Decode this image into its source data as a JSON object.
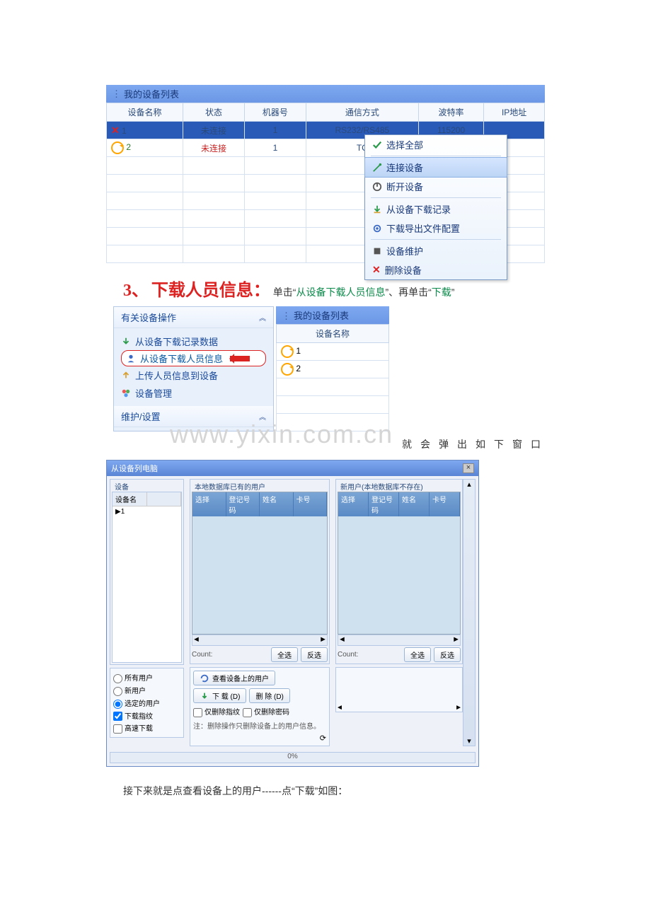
{
  "deviceListTitle": "我的设备列表",
  "table1": {
    "headers": [
      "设备名称",
      "状态",
      "机器号",
      "通信方式",
      "波特率",
      "IP地址"
    ],
    "rows": [
      {
        "name": "1",
        "status": "未连接",
        "machine": "1",
        "comm": "RS232/RS485",
        "baud": "115200",
        "ip": ""
      },
      {
        "name": "2",
        "status": "未连接",
        "machine": "1",
        "comm": "TC",
        "baud": "",
        "ip": ""
      }
    ]
  },
  "contextMenu": {
    "selectAll": "选择全部",
    "connect": "连接设备",
    "disconnect": "断开设备",
    "downloadRecords": "从设备下载记录",
    "exportConfig": "下载导出文件配置",
    "maintain": "设备维护",
    "delete": "删除设备"
  },
  "heading": {
    "num": "3、",
    "title": "下载人员信息：",
    "pre": "单击“",
    "link1": "从设备下载人员信息",
    "mid": "”、再单击“",
    "link2": "下载",
    "post": "”"
  },
  "sidePanel": {
    "header1": "有关设备操作",
    "item1": "从设备下载记录数据",
    "item2": "从设备下载人员信息",
    "item3": "上传人员信息到设备",
    "item4": "设备管理",
    "header2": "维护/设置"
  },
  "deviceList2": {
    "title": "我的设备列表",
    "header": "设备名称",
    "rows": [
      "1",
      "2"
    ]
  },
  "popupText": [
    "就",
    "会",
    "弹",
    "出",
    "如",
    "下",
    "窗",
    "口"
  ],
  "watermark": "www.yixin.com.cn",
  "dialog": {
    "title": "从设备列电脑",
    "leftHeader": "设备",
    "leftCols": [
      "设备名",
      ""
    ],
    "leftRow": "1",
    "midLegend": "本地数据库已有的用户",
    "rightLegend": "新用户(本地数据库不存在)",
    "gridCols": [
      "选择",
      "登记号码",
      "姓名",
      "卡号"
    ],
    "count": "Count:",
    "btnSelectAll": "全选",
    "btnInvert": "反选",
    "radios": {
      "all": "所有用户",
      "new": "新用户",
      "selected": "选定的用户"
    },
    "chkFingerprint": "下载指纹",
    "chkFast": "高速下载",
    "btnView": "查看设备上的用户",
    "btnDownload": "下 载 (D)",
    "btnDelete": "删 除 (D)",
    "chkDelFp": "仅删除指纹",
    "chkDelPwd": "仅删除密码",
    "note": "注：删除操作只删除设备上的用户信息。",
    "progress": "0%"
  },
  "finalPara": "接下来就是点查看设备上的用户------点“下载”如图："
}
